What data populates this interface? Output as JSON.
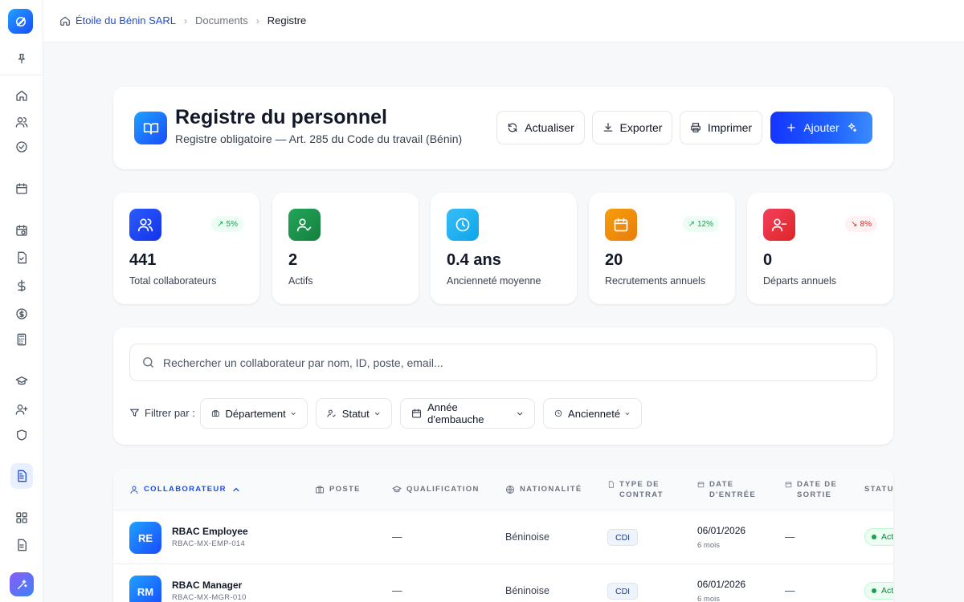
{
  "breadcrumb": {
    "company": "Étoile du Bénin SARL",
    "section": "Documents",
    "current": "Registre"
  },
  "header": {
    "title": "Registre du personnel",
    "subtitle": "Registre obligatoire — Art. 285 du Code du travail (Bénin)",
    "buttons": {
      "refresh": "Actualiser",
      "export": "Exporter",
      "print": "Imprimer",
      "add": "Ajouter"
    }
  },
  "stats": [
    {
      "value": "441",
      "label": "Total collaborateurs",
      "trend": "5%",
      "trend_dir": "up",
      "color": "#1a4bff",
      "icon": "users-icon"
    },
    {
      "value": "2",
      "label": "Actifs",
      "trend": "",
      "trend_dir": "",
      "color": "#16a34a",
      "icon": "user-check-icon"
    },
    {
      "value": "0.4 ans",
      "label": "Ancienneté moyenne",
      "trend": "",
      "trend_dir": "",
      "color": "#0ea5e9",
      "icon": "clock-icon"
    },
    {
      "value": "20",
      "label": "Recrutements annuels",
      "trend": "12%",
      "trend_dir": "up",
      "color": "#f59e0b",
      "icon": "calendar-icon"
    },
    {
      "value": "0",
      "label": "Départs annuels",
      "trend": "8%",
      "trend_dir": "down",
      "color": "#ef4444",
      "icon": "user-minus-icon"
    }
  ],
  "search": {
    "placeholder": "Rechercher un collaborateur par nom, ID, poste, email..."
  },
  "filters": {
    "label": "Filtrer par :",
    "department": "Département",
    "status": "Statut",
    "hire_year": "Année d'embauche",
    "seniority": "Ancienneté"
  },
  "table": {
    "headers": {
      "employee": "COLLABORATEUR",
      "position": "POSTE",
      "qualification": "QUALIFICATION",
      "nationality": "NATIONALITÉ",
      "contract_l1": "TYPE DE",
      "contract_l2": "CONTRAT",
      "entry_l1": "DATE",
      "entry_l2": "D'ENTRÉE",
      "exit_l1": "DATE DE",
      "exit_l2": "SORTIE",
      "status": "STATUT"
    },
    "rows": [
      {
        "initials": "RE",
        "name": "RBAC Employee",
        "id": "RBAC-MX-EMP-014",
        "position": "",
        "qualification": "—",
        "nationality": "Béninoise",
        "contract": "CDI",
        "entry_date": "06/01/2026",
        "entry_ago": "6 mois",
        "exit_date": "—",
        "status": "Actif"
      },
      {
        "initials": "RM",
        "name": "RBAC Manager",
        "id": "RBAC-MX-MGR-010",
        "position": "",
        "qualification": "—",
        "nationality": "Béninoise",
        "contract": "CDI",
        "entry_date": "06/01/2026",
        "entry_ago": "6 mois",
        "exit_date": "—",
        "status": "Actif"
      }
    ]
  }
}
